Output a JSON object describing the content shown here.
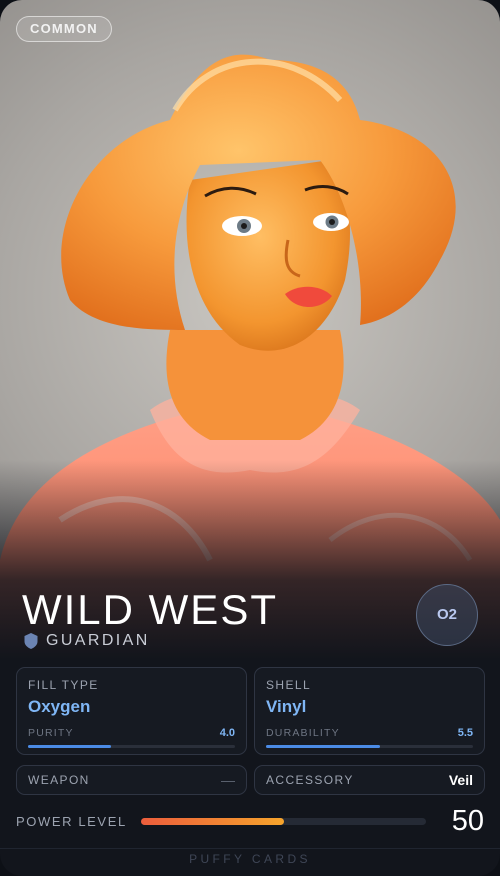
{
  "card": {
    "rarity": "COMMON",
    "title": "WILD WEST",
    "class_icon": "shield-icon",
    "class_label": "GUARDIAN",
    "element_badge": "O2",
    "image_alt": "inflatable-cowgirl-figure"
  },
  "stats": {
    "fill": {
      "caption": "FILL TYPE",
      "value": "Oxygen",
      "sub_label": "PURITY",
      "sub_value": "4.0",
      "level": 0.4
    },
    "shell": {
      "caption": "SHELL",
      "value": "Vinyl",
      "sub_label": "DURABILITY",
      "sub_value": "5.5",
      "level": 0.55
    }
  },
  "slots": {
    "weapon": {
      "caption": "WEAPON",
      "value": "—"
    },
    "accessory": {
      "caption": "ACCESSORY",
      "value": "Veil"
    }
  },
  "power": {
    "caption": "POWER LEVEL",
    "value": "50",
    "level": 0.5
  },
  "footer": "PUFFY CARDS",
  "colors": {
    "accent": "#7fb6f5",
    "bar_fill": "#4b8be6",
    "power_start": "#ec5d3c",
    "power_end": "#f6a42c",
    "badge_text": "#b9c8ef"
  }
}
